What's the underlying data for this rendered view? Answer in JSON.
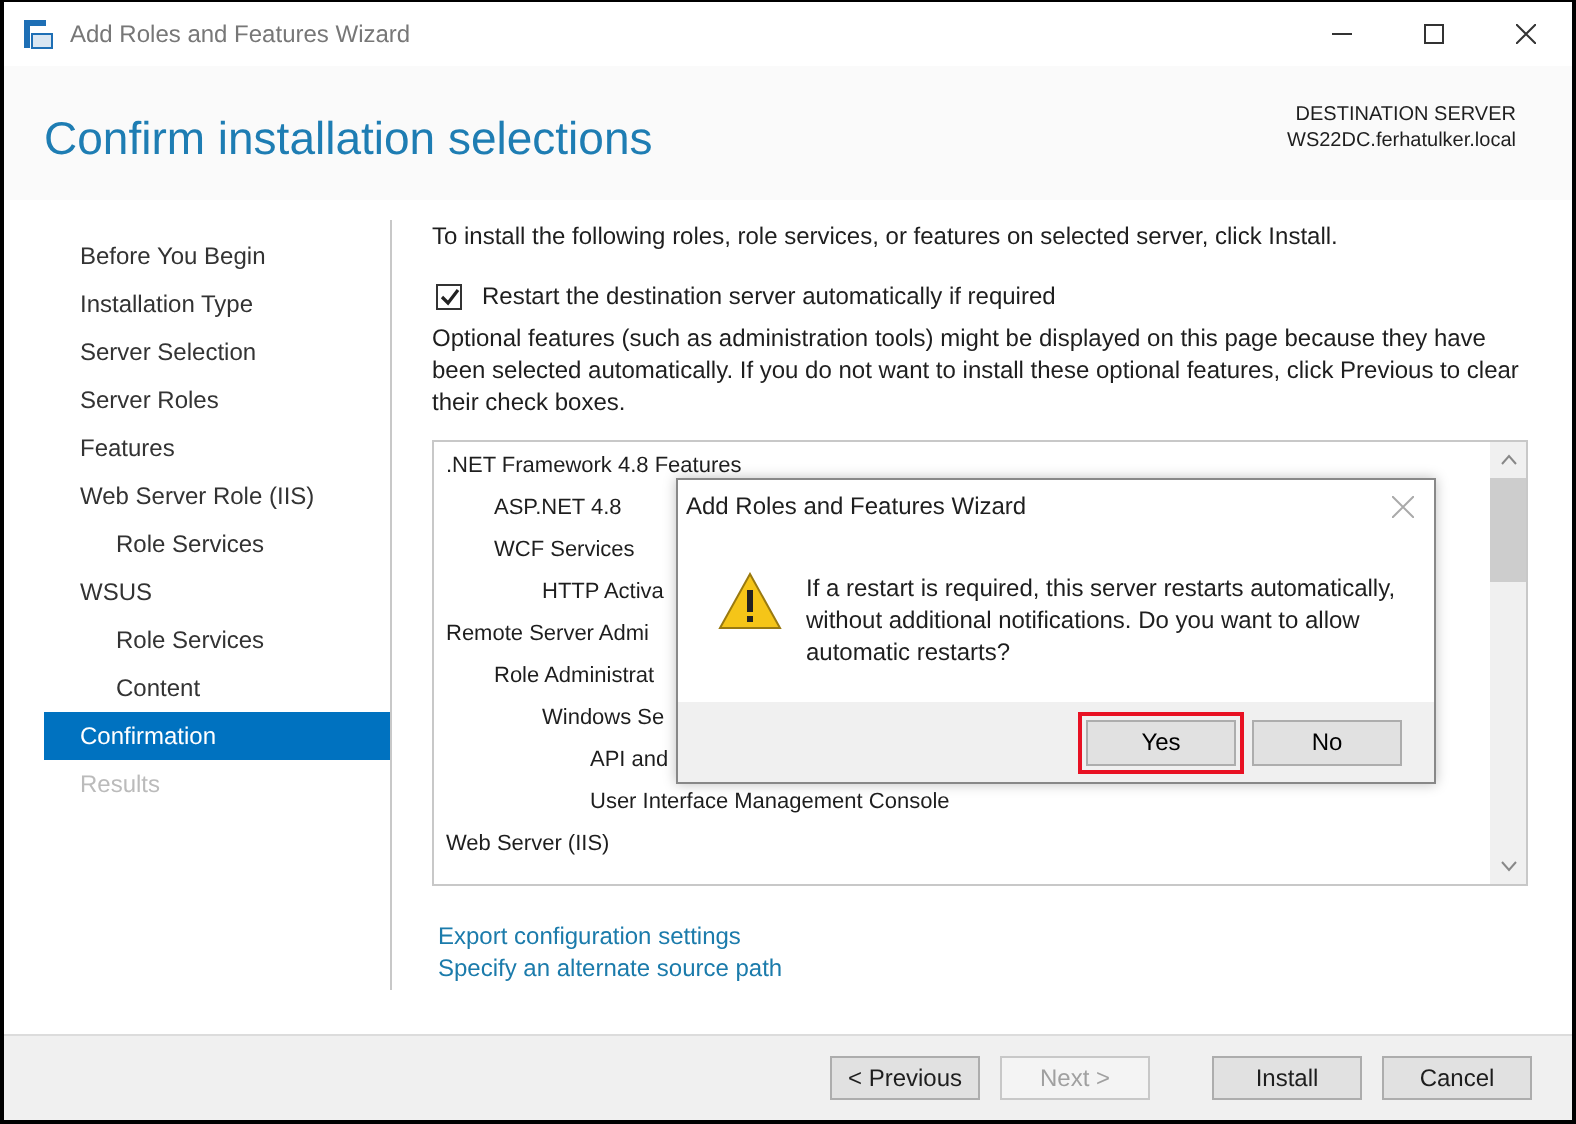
{
  "window": {
    "title": "Add Roles and Features Wizard"
  },
  "header": {
    "title": "Confirm installation selections",
    "destination_label": "DESTINATION SERVER",
    "destination_server": "WS22DC.ferhatulker.local"
  },
  "sidebar": {
    "items": [
      {
        "label": "Before You Begin",
        "selected": false,
        "disabled": false,
        "indented": false
      },
      {
        "label": "Installation Type",
        "selected": false,
        "disabled": false,
        "indented": false
      },
      {
        "label": "Server Selection",
        "selected": false,
        "disabled": false,
        "indented": false
      },
      {
        "label": "Server Roles",
        "selected": false,
        "disabled": false,
        "indented": false
      },
      {
        "label": "Features",
        "selected": false,
        "disabled": false,
        "indented": false
      },
      {
        "label": "Web Server Role (IIS)",
        "selected": false,
        "disabled": false,
        "indented": false
      },
      {
        "label": "Role Services",
        "selected": false,
        "disabled": false,
        "indented": true
      },
      {
        "label": "WSUS",
        "selected": false,
        "disabled": false,
        "indented": false
      },
      {
        "label": "Role Services",
        "selected": false,
        "disabled": false,
        "indented": true
      },
      {
        "label": "Content",
        "selected": false,
        "disabled": false,
        "indented": true
      },
      {
        "label": "Confirmation",
        "selected": true,
        "disabled": false,
        "indented": false
      },
      {
        "label": "Results",
        "selected": false,
        "disabled": true,
        "indented": false
      }
    ]
  },
  "content": {
    "intro": "To install the following roles, role services, or features on selected server, click Install.",
    "restart_checkbox": {
      "label": "Restart the destination server automatically if required",
      "checked": true
    },
    "note": "Optional features (such as administration tools) might be displayed on this page because they have been selected automatically. If you do not want to install these optional features, click Previous to clear their check boxes.",
    "features": [
      {
        "label": ".NET Framework 4.8 Features",
        "children": [
          {
            "label": "ASP.NET 4.8"
          },
          {
            "label": "WCF Services",
            "children": [
              {
                "label": "HTTP Activa"
              }
            ]
          }
        ]
      },
      {
        "label": "Remote Server Admi",
        "children": [
          {
            "label": "Role Administrat",
            "children": [
              {
                "label": "Windows Se",
                "children": [
                  {
                    "label": "API and"
                  },
                  {
                    "label": "User Interface Management Console"
                  }
                ]
              }
            ]
          }
        ]
      },
      {
        "label": "Web Server (IIS)"
      }
    ],
    "links": [
      "Export configuration settings",
      "Specify an alternate source path"
    ]
  },
  "footer": {
    "buttons": [
      {
        "label": "< Previous",
        "disabled": false
      },
      {
        "label": "Next >",
        "disabled": true
      },
      {
        "label": "Install",
        "disabled": false
      },
      {
        "label": "Cancel",
        "disabled": false
      }
    ]
  },
  "dialog": {
    "title": "Add Roles and Features Wizard",
    "message": "If a restart is required, this server restarts automatically, without additional notifications. Do you want to allow automatic restarts?",
    "buttons": [
      {
        "label": "Yes",
        "highlighted": true
      },
      {
        "label": "No",
        "highlighted": false
      }
    ]
  }
}
